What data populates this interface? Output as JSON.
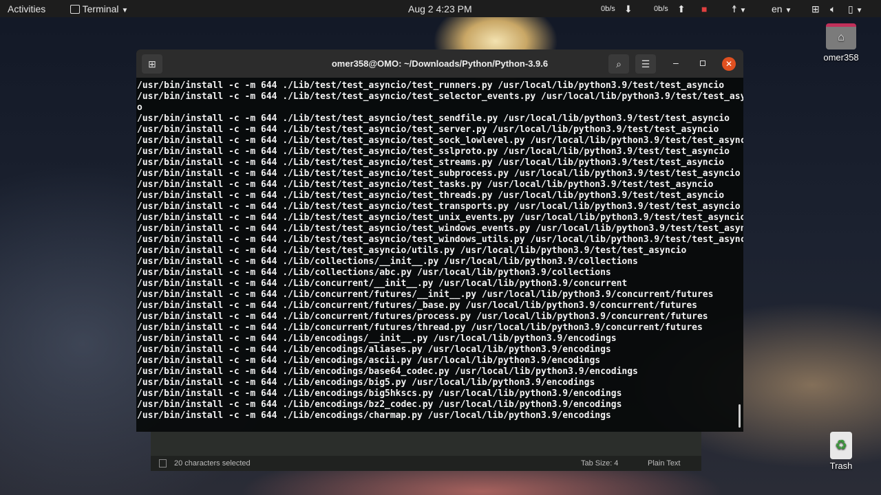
{
  "topbar": {
    "activities": "Activities",
    "app_menu": "Terminal",
    "clock": "Aug 2  4:23 PM",
    "net_down": "0b/s",
    "net_up": "0b/s",
    "language": "en"
  },
  "desktop": {
    "home_label": "omer358",
    "trash_label": "Trash"
  },
  "background_editor": {
    "status": "20 characters selected",
    "tab_size": "Tab Size: 4",
    "language": "Plain Text"
  },
  "terminal": {
    "title": "omer358@OMO: ~/Downloads/Python/Python-3.9.6",
    "lines": [
      "/usr/bin/install -c -m 644 ./Lib/test/test_asyncio/test_runners.py /usr/local/lib/python3.9/test/test_asyncio",
      "/usr/bin/install -c -m 644 ./Lib/test/test_asyncio/test_selector_events.py /usr/local/lib/python3.9/test/test_asynci",
      "o",
      "/usr/bin/install -c -m 644 ./Lib/test/test_asyncio/test_sendfile.py /usr/local/lib/python3.9/test/test_asyncio",
      "/usr/bin/install -c -m 644 ./Lib/test/test_asyncio/test_server.py /usr/local/lib/python3.9/test/test_asyncio",
      "/usr/bin/install -c -m 644 ./Lib/test/test_asyncio/test_sock_lowlevel.py /usr/local/lib/python3.9/test/test_asyncio",
      "/usr/bin/install -c -m 644 ./Lib/test/test_asyncio/test_sslproto.py /usr/local/lib/python3.9/test/test_asyncio",
      "/usr/bin/install -c -m 644 ./Lib/test/test_asyncio/test_streams.py /usr/local/lib/python3.9/test/test_asyncio",
      "/usr/bin/install -c -m 644 ./Lib/test/test_asyncio/test_subprocess.py /usr/local/lib/python3.9/test/test_asyncio",
      "/usr/bin/install -c -m 644 ./Lib/test/test_asyncio/test_tasks.py /usr/local/lib/python3.9/test/test_asyncio",
      "/usr/bin/install -c -m 644 ./Lib/test/test_asyncio/test_threads.py /usr/local/lib/python3.9/test/test_asyncio",
      "/usr/bin/install -c -m 644 ./Lib/test/test_asyncio/test_transports.py /usr/local/lib/python3.9/test/test_asyncio",
      "/usr/bin/install -c -m 644 ./Lib/test/test_asyncio/test_unix_events.py /usr/local/lib/python3.9/test/test_asyncio",
      "/usr/bin/install -c -m 644 ./Lib/test/test_asyncio/test_windows_events.py /usr/local/lib/python3.9/test/test_asyncio",
      "/usr/bin/install -c -m 644 ./Lib/test/test_asyncio/test_windows_utils.py /usr/local/lib/python3.9/test/test_asyncio",
      "/usr/bin/install -c -m 644 ./Lib/test/test_asyncio/utils.py /usr/local/lib/python3.9/test/test_asyncio",
      "/usr/bin/install -c -m 644 ./Lib/collections/__init__.py /usr/local/lib/python3.9/collections",
      "/usr/bin/install -c -m 644 ./Lib/collections/abc.py /usr/local/lib/python3.9/collections",
      "/usr/bin/install -c -m 644 ./Lib/concurrent/__init__.py /usr/local/lib/python3.9/concurrent",
      "/usr/bin/install -c -m 644 ./Lib/concurrent/futures/__init__.py /usr/local/lib/python3.9/concurrent/futures",
      "/usr/bin/install -c -m 644 ./Lib/concurrent/futures/_base.py /usr/local/lib/python3.9/concurrent/futures",
      "/usr/bin/install -c -m 644 ./Lib/concurrent/futures/process.py /usr/local/lib/python3.9/concurrent/futures",
      "/usr/bin/install -c -m 644 ./Lib/concurrent/futures/thread.py /usr/local/lib/python3.9/concurrent/futures",
      "/usr/bin/install -c -m 644 ./Lib/encodings/__init__.py /usr/local/lib/python3.9/encodings",
      "/usr/bin/install -c -m 644 ./Lib/encodings/aliases.py /usr/local/lib/python3.9/encodings",
      "/usr/bin/install -c -m 644 ./Lib/encodings/ascii.py /usr/local/lib/python3.9/encodings",
      "/usr/bin/install -c -m 644 ./Lib/encodings/base64_codec.py /usr/local/lib/python3.9/encodings",
      "/usr/bin/install -c -m 644 ./Lib/encodings/big5.py /usr/local/lib/python3.9/encodings",
      "/usr/bin/install -c -m 644 ./Lib/encodings/big5hkscs.py /usr/local/lib/python3.9/encodings",
      "/usr/bin/install -c -m 644 ./Lib/encodings/bz2_codec.py /usr/local/lib/python3.9/encodings",
      "/usr/bin/install -c -m 644 ./Lib/encodings/charmap.py /usr/local/lib/python3.9/encodings"
    ]
  }
}
